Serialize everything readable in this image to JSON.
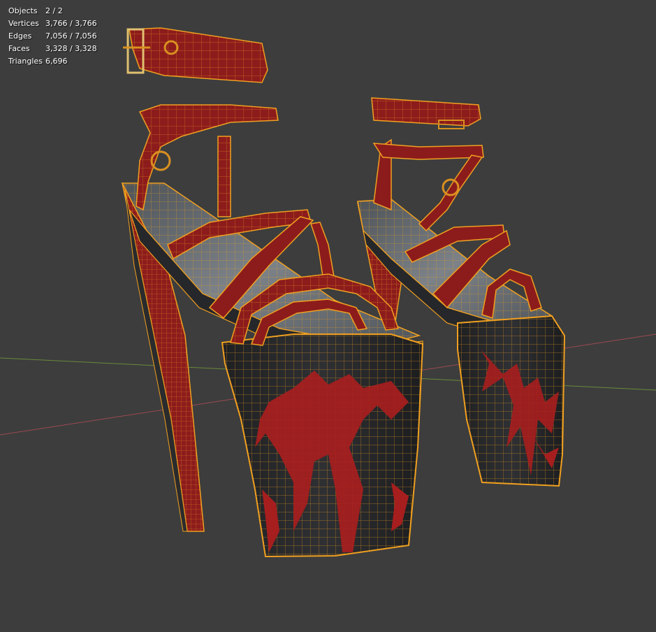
{
  "stats": [
    {
      "label": "Objects",
      "value": "2 / 2"
    },
    {
      "label": "Vertices",
      "value": "3,766 / 3,766"
    },
    {
      "label": "Edges",
      "value": "7,056 / 7,056"
    },
    {
      "label": "Faces",
      "value": "3,328 / 3,328"
    },
    {
      "label": "Triangles",
      "value": "6,696"
    }
  ],
  "colors": {
    "background": "#3d3d3d",
    "x_axis": "#9a4a52",
    "y_axis": "#6a8a3a",
    "wire": "#f0a020",
    "strap": "#8c1c1c",
    "sole": "#2a2b2d",
    "footbed": "#6f757b",
    "pattern": "#a71e1e"
  },
  "icons": [
    "overlay-statistics"
  ]
}
